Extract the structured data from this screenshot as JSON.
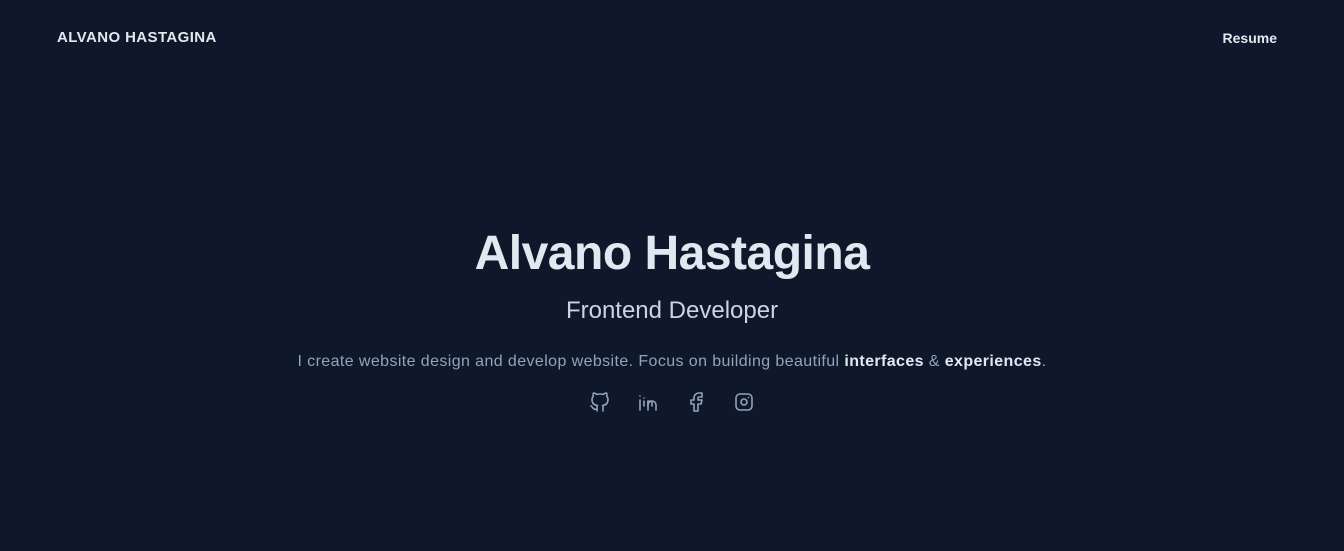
{
  "header": {
    "brand": "ALVANO HASTAGINA",
    "nav_resume": "Resume"
  },
  "hero": {
    "name": "Alvano Hastagina",
    "role": "Frontend Developer",
    "description_prefix": "I create website design and develop website. Focus on building beautiful ",
    "highlight_1": "interfaces",
    "description_joiner": " & ",
    "highlight_2": "experiences",
    "description_suffix": "."
  },
  "socials": [
    {
      "icon": "github-icon"
    },
    {
      "icon": "linkedin-icon"
    },
    {
      "icon": "facebook-icon"
    },
    {
      "icon": "instagram-icon"
    }
  ],
  "colors": {
    "background": "#0f172a",
    "heading": "#e2e8f0",
    "subheading": "#cbd5e1",
    "muted": "#94a3b8"
  }
}
